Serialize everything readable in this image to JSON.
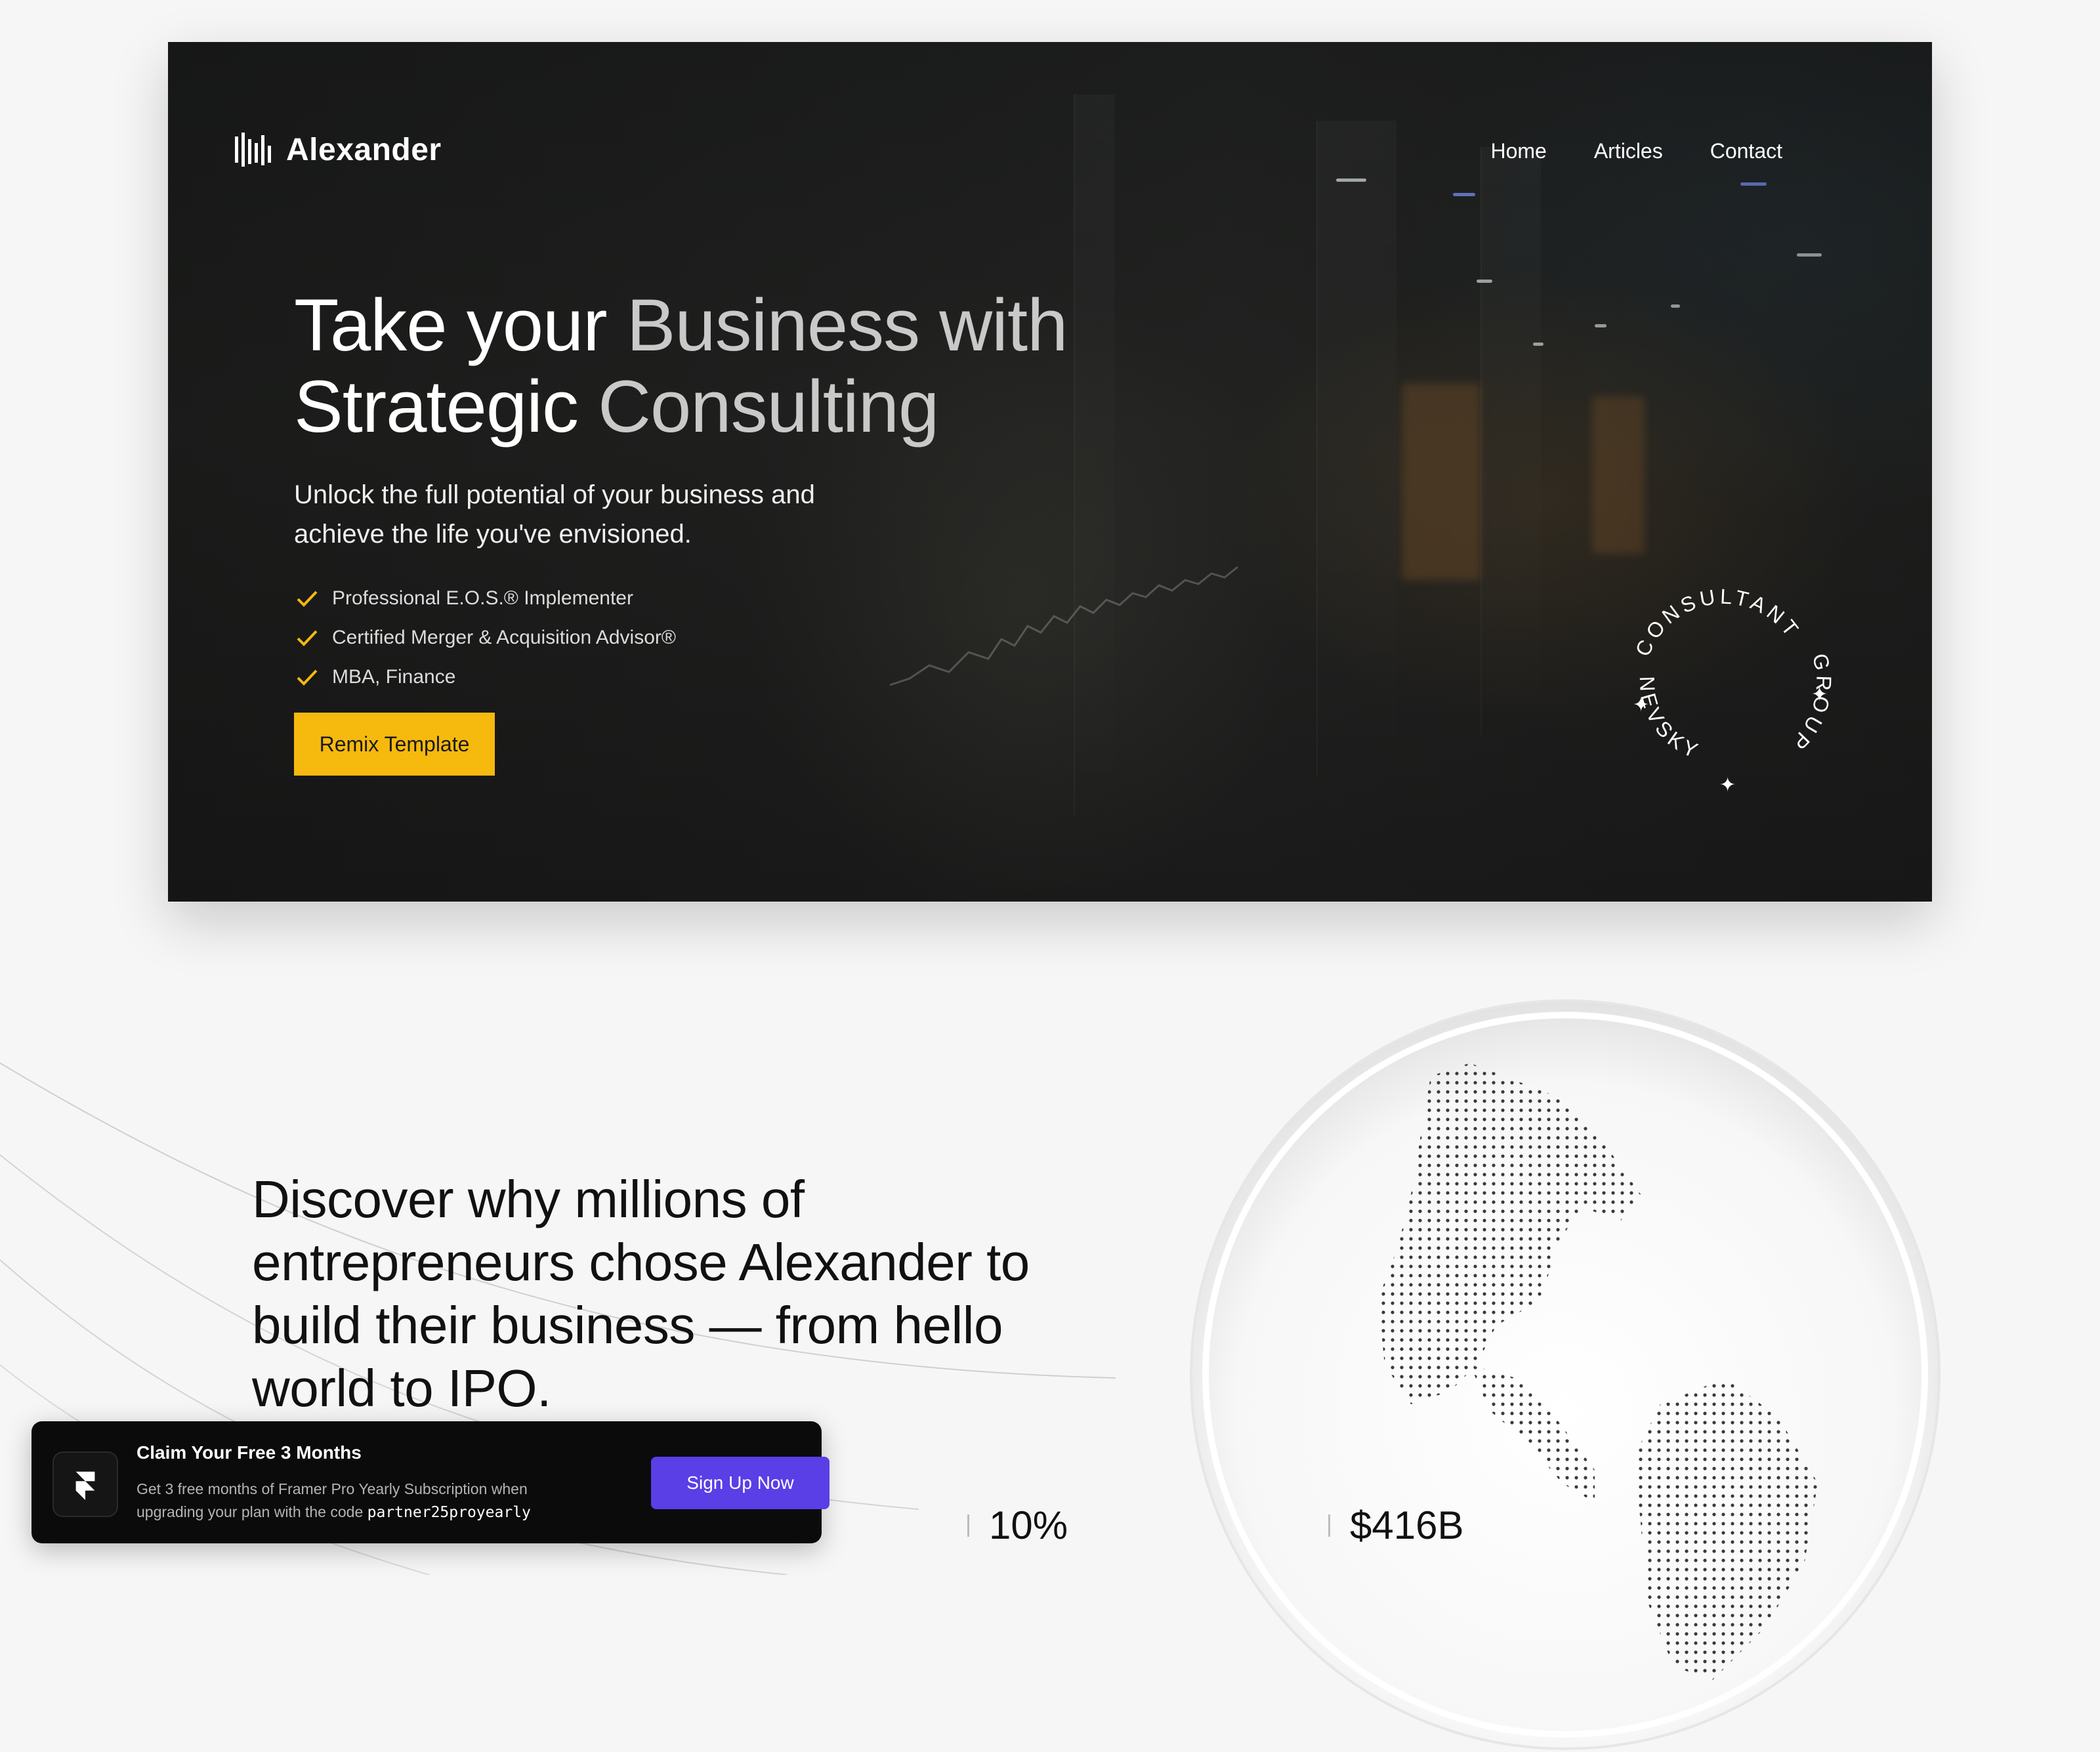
{
  "brand": {
    "name": "Alexander",
    "logo_icon": "bars-logo-icon"
  },
  "nav": {
    "items": [
      {
        "label": "Home"
      },
      {
        "label": "Articles"
      },
      {
        "label": "Contact"
      }
    ]
  },
  "hero": {
    "headline_line1_a": "Take your ",
    "headline_line1_b": "Business with",
    "headline_line2_a": "Strategic ",
    "headline_line2_b": "Consulting",
    "subtitle_line1": "Unlock the full potential of your business and",
    "subtitle_line2": "achieve the life you've envisioned.",
    "checklist": [
      {
        "text": "Professional E.O.S.® Implementer"
      },
      {
        "text": "Certified Merger & Acquisition Advisor®"
      },
      {
        "text": "MBA, Finance"
      }
    ],
    "cta_label": "Remix Template",
    "badge": {
      "top_text": "CONSULTANT",
      "right_text": "GROUP",
      "bottom_text": "NEVSKY"
    },
    "accent_color": "#f6b90e"
  },
  "section": {
    "title_line1": "Discover why millions of",
    "title_line2": "entrepreneurs chose Alexander to",
    "title_line3": "build their business — from hello",
    "title_line4": "world to IPO.",
    "stats": [
      {
        "value": "10%"
      },
      {
        "value": "$416B"
      }
    ]
  },
  "promo": {
    "title": "Claim Your Free 3 Months",
    "text": "Get 3 free months of Framer Pro Yearly Subscription when upgrading your plan with the code",
    "code": "partner25proyearly",
    "button_label": "Sign Up Now",
    "button_color": "#5a3ee6",
    "icon": "framer-icon"
  }
}
